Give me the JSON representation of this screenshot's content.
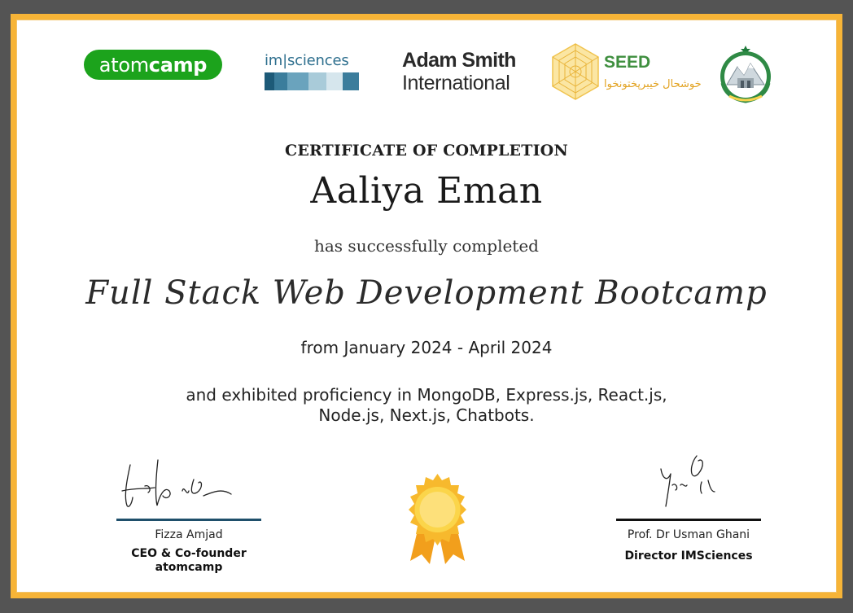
{
  "logos": {
    "atomcamp": {
      "light": "atom",
      "bold": "camp"
    },
    "imsciences": "im|sciences",
    "adam_smith": {
      "line1": "Adam Smith",
      "line2": "International"
    },
    "seed": {
      "word": "SEED",
      "urdu": "خوشحال خیبرپختونخوا"
    }
  },
  "certificate": {
    "heading": "CERTIFICATE OF COMPLETION",
    "recipient": "Aaliya Eman",
    "completed_text": "has successfully completed",
    "course": "Full Stack Web Development Bootcamp",
    "dates": "from January 2024 - April 2024",
    "skills_line1": "and exhibited proficiency in MongoDB, Express.js, React.js,",
    "skills_line2": "Node.js, Next.js, Chatbots."
  },
  "signatories": {
    "left": {
      "name": "Fizza Amjad",
      "title_line1": "CEO & Co-founder",
      "title_line2": "atomcamp"
    },
    "right": {
      "name": "Prof. Dr Usman Ghani",
      "title_line1": "Director IMSciences"
    }
  },
  "colors": {
    "border": "#f7b437",
    "atomcamp_green": "#1ca31c",
    "ims_blue": "#2e6f8e",
    "seed_green": "#3f8f3f",
    "seed_gold": "#e2a21f",
    "sig_line_left": "#1f4f6b",
    "sig_line_right": "#111111",
    "badge": "#f6be25"
  }
}
